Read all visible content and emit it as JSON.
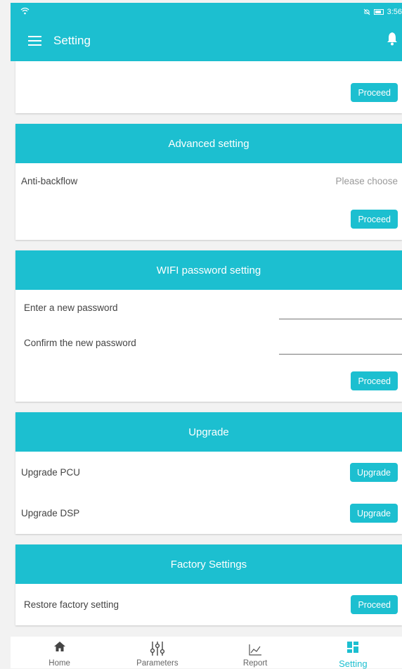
{
  "status_bar": {
    "time": "3:56"
  },
  "header": {
    "title": "Setting"
  },
  "top_card": {
    "proceed_label": "Proceed"
  },
  "advanced": {
    "title": "Advanced setting",
    "anti_backflow_label": "Anti-backflow",
    "anti_backflow_value": "Please choose",
    "proceed_label": "Proceed"
  },
  "wifi": {
    "title": "WIFI password setting",
    "new_password_label": "Enter a new password",
    "confirm_password_label": "Confirm the new password",
    "proceed_label": "Proceed"
  },
  "upgrade": {
    "title": "Upgrade",
    "pcu_label": "Upgrade PCU",
    "dsp_label": "Upgrade DSP",
    "button_label": "Upgrade"
  },
  "factory": {
    "title": "Factory Settings",
    "restore_label": "Restore factory setting",
    "proceed_label": "Proceed"
  },
  "nav": {
    "items": [
      {
        "label": "Home",
        "icon": "home-icon"
      },
      {
        "label": "Parameters",
        "icon": "sliders-icon"
      },
      {
        "label": "Report",
        "icon": "chart-icon"
      },
      {
        "label": "Setting",
        "icon": "grid-icon"
      }
    ],
    "active": "Setting"
  },
  "colors": {
    "accent": "#1cbfd0"
  }
}
